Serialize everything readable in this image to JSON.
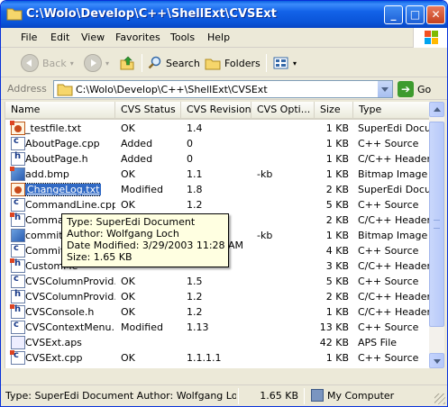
{
  "window": {
    "title": "C:\\Wolo\\Develop\\C++\\ShellExt\\CVSExt",
    "minimize_label": "_",
    "maximize_label": "□",
    "close_label": "✕"
  },
  "menu": [
    "File",
    "Edit",
    "View",
    "Favorites",
    "Tools",
    "Help"
  ],
  "toolbar": {
    "back_label": "Back",
    "search_label": "Search",
    "folders_label": "Folders"
  },
  "address": {
    "label": "Address",
    "value": "C:\\Wolo\\Develop\\C++\\ShellExt\\CVSExt",
    "go_label": "Go"
  },
  "columns": [
    "Name",
    "CVS Status",
    "CVS Revision",
    "CVS Opti...",
    "Size",
    "Type"
  ],
  "files": [
    {
      "name": "_testfile.txt",
      "status": "OK",
      "revision": "1.4",
      "options": "",
      "size": "1 KB",
      "type": "SuperEdi Document",
      "icon": "doc"
    },
    {
      "name": "AboutPage.cpp",
      "status": "Added",
      "revision": "0",
      "options": "",
      "size": "1 KB",
      "type": "C++ Source",
      "icon": "cpp"
    },
    {
      "name": "AboutPage.h",
      "status": "Added",
      "revision": "0",
      "options": "",
      "size": "1 KB",
      "type": "C/C++ Header",
      "icon": "h"
    },
    {
      "name": "add.bmp",
      "status": "OK",
      "revision": "1.1",
      "options": "-kb",
      "size": "1 KB",
      "type": "Bitmap Image",
      "icon": "bmp"
    },
    {
      "name": "ChangeLog.txt",
      "status": "Modified",
      "revision": "1.8",
      "options": "",
      "size": "2 KB",
      "type": "SuperEdi Document",
      "icon": "doc"
    },
    {
      "name": "CommandLine.cpp",
      "status": "OK",
      "revision": "1.2",
      "options": "",
      "size": "5 KB",
      "type": "C++ Source",
      "icon": "cpp"
    },
    {
      "name": "Command",
      "status": "",
      "revision": "",
      "options": "",
      "size": "2 KB",
      "type": "C/C++ Header",
      "icon": "h"
    },
    {
      "name": "commit.",
      "status": "",
      "revision": "",
      "options": "-kb",
      "size": "1 KB",
      "type": "Bitmap Image",
      "icon": "bmp"
    },
    {
      "name": "CommitD",
      "status": "",
      "revision": "",
      "options": "",
      "size": "4 KB",
      "type": "C++ Source",
      "icon": "cpp"
    },
    {
      "name": "CustomMe",
      "status": "",
      "revision": "",
      "options": "",
      "size": "3 KB",
      "type": "C/C++ Header",
      "icon": "h"
    },
    {
      "name": "CVSColumnProvid...",
      "status": "OK",
      "revision": "1.5",
      "options": "",
      "size": "5 KB",
      "type": "C++ Source",
      "icon": "cpp"
    },
    {
      "name": "CVSColumnProvid...",
      "status": "OK",
      "revision": "1.2",
      "options": "",
      "size": "2 KB",
      "type": "C/C++ Header",
      "icon": "h"
    },
    {
      "name": "CVSConsole.h",
      "status": "OK",
      "revision": "1.2",
      "options": "",
      "size": "1 KB",
      "type": "C/C++ Header",
      "icon": "h"
    },
    {
      "name": "CVSContextMenu...",
      "status": "Modified",
      "revision": "1.13",
      "options": "",
      "size": "13 KB",
      "type": "C++ Source",
      "icon": "cpp"
    },
    {
      "name": "CVSExt.aps",
      "status": "",
      "revision": "",
      "options": "",
      "size": "42 KB",
      "type": "APS File",
      "icon": "aps"
    },
    {
      "name": "CVSExt.cpp",
      "status": "OK",
      "revision": "1.1.1.1",
      "options": "",
      "size": "1 KB",
      "type": "C++ Source",
      "icon": "cpp"
    }
  ],
  "tooltip": {
    "type": "Type: SuperEdi Document",
    "author": "Author: Wolfgang Loch",
    "modified": "Date Modified: 3/29/2003 11:28 AM",
    "size": "Size: 1.65 KB"
  },
  "status": {
    "text": "Type: SuperEdi Document Author: Wolfgang Loch Da",
    "size": "1.65 KB",
    "zone": "My Computer"
  },
  "colors": {
    "titlebar": "#0a54d8",
    "selection": "#316ac5",
    "tooltip_bg": "#ffffe1"
  },
  "icons": [
    "folder-icon",
    "back-icon",
    "forward-icon",
    "up-folder-icon",
    "search-icon",
    "folders-icon",
    "views-icon",
    "go-icon",
    "windows-logo-icon",
    "my-computer-icon"
  ]
}
